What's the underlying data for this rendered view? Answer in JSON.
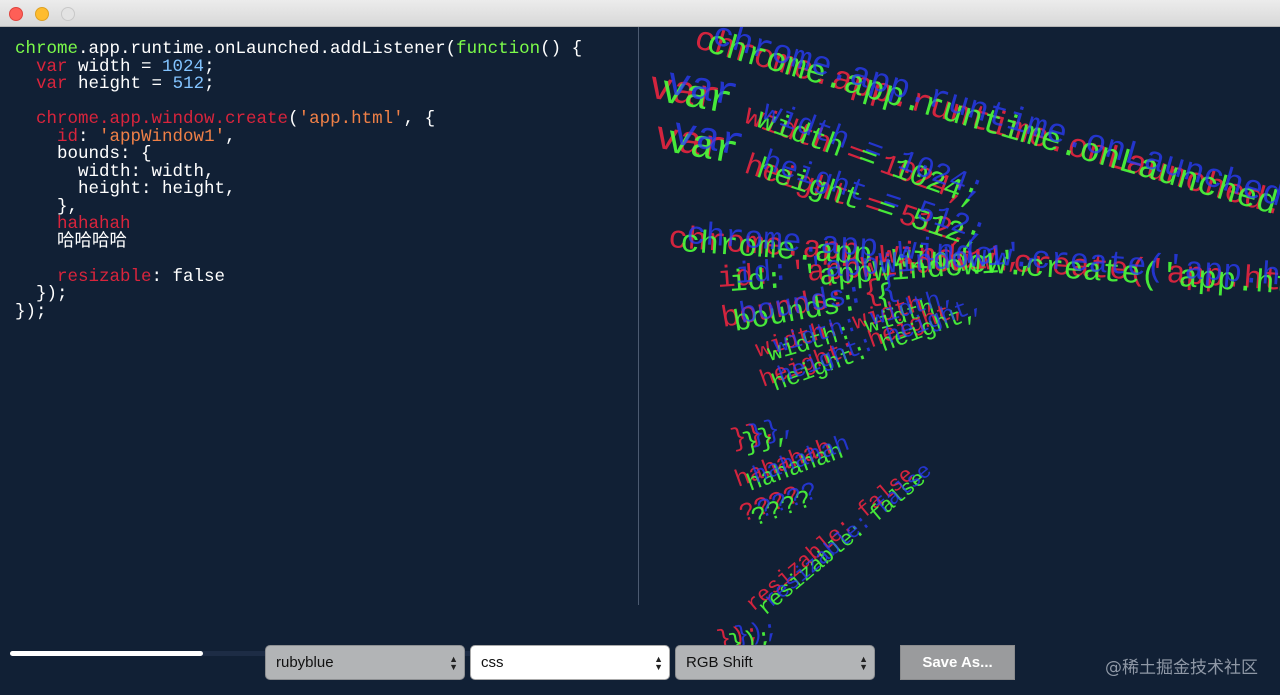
{
  "code_lines": [
    [
      {
        "t": "chrome",
        "c": "green"
      },
      {
        "t": ".app.runtime.onLaunched.addListener(",
        "c": "white"
      },
      {
        "t": "function",
        "c": "green"
      },
      {
        "t": "() {",
        "c": "white"
      }
    ],
    [
      {
        "t": "  ",
        "c": "white"
      },
      {
        "t": "var",
        "c": "red"
      },
      {
        "t": " width = ",
        "c": "white"
      },
      {
        "t": "1024",
        "c": "blue"
      },
      {
        "t": ";",
        "c": "white"
      }
    ],
    [
      {
        "t": "  ",
        "c": "white"
      },
      {
        "t": "var",
        "c": "red"
      },
      {
        "t": " height = ",
        "c": "white"
      },
      {
        "t": "512",
        "c": "blue"
      },
      {
        "t": ";",
        "c": "white"
      }
    ],
    [],
    [
      {
        "t": "  ",
        "c": "white"
      },
      {
        "t": "chrome.app.window.create",
        "c": "red"
      },
      {
        "t": "(",
        "c": "white"
      },
      {
        "t": "'app.html'",
        "c": "str"
      },
      {
        "t": ", {",
        "c": "white"
      }
    ],
    [
      {
        "t": "    ",
        "c": "white"
      },
      {
        "t": "id",
        "c": "red"
      },
      {
        "t": ": ",
        "c": "white"
      },
      {
        "t": "'appWindow1'",
        "c": "str"
      },
      {
        "t": ",",
        "c": "white"
      }
    ],
    [
      {
        "t": "    bounds: {",
        "c": "white"
      }
    ],
    [
      {
        "t": "      width: width,",
        "c": "white"
      }
    ],
    [
      {
        "t": "      height: height,",
        "c": "white"
      }
    ],
    [
      {
        "t": "    },",
        "c": "white"
      }
    ],
    [
      {
        "t": "    ",
        "c": "white"
      },
      {
        "t": "hahahah",
        "c": "red"
      }
    ],
    [
      {
        "t": "    哈哈哈哈",
        "c": "white"
      }
    ],
    [],
    [
      {
        "t": "    ",
        "c": "white"
      },
      {
        "t": "resizable",
        "c": "red"
      },
      {
        "t": ": false",
        "c": "white"
      }
    ],
    [
      {
        "t": "  });",
        "c": "white"
      }
    ],
    [
      {
        "t": "});",
        "c": "white"
      }
    ]
  ],
  "syntax_colors": {
    "green": "#7cfc4a",
    "red": "#d9243c",
    "blue": "#82c3ff",
    "str": "#f08047",
    "white": "#ffffff"
  },
  "preview": {
    "texts": [
      "chrome.app.runtime.onLaunched.addListener(function() {",
      "var",
      "width = 1024;",
      "var",
      "height = 512;",
      "chrome.app.window.create('app.html', {",
      "id: 'appWindow1',",
      "bounds: {",
      "width: width,",
      "height: height,",
      "}},",
      "hahahah",
      "????",
      "resizable: false",
      "});"
    ],
    "channel_colors": [
      "#e8253f",
      "#4cff3a",
      "#2a3cff"
    ]
  },
  "controls": {
    "progress": 0.41,
    "theme_select": "rubyblue",
    "mode_select": "css",
    "effect_select": "RGB Shift",
    "save_label": "Save As...",
    "select_arrows": "▲▼"
  },
  "watermark": "@稀土掘金技术社区"
}
